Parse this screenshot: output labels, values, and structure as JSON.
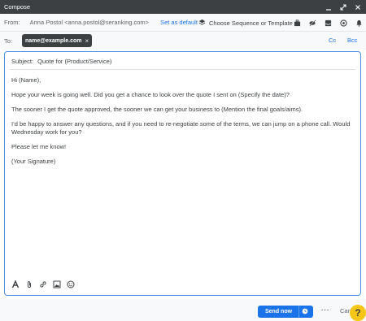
{
  "window": {
    "title": "Compose"
  },
  "from": {
    "label": "From:",
    "sender": "Anna Postol <anna.postol@seranking.com>",
    "set_default": "Set as default",
    "sequence_label": "Choose Sequence or Template"
  },
  "to": {
    "label": "To:",
    "recipient": "name@example.com",
    "cc": "Cc",
    "bcc": "Bcc"
  },
  "subject": {
    "label": "Subject:",
    "value": "Quote for (Product/Service)"
  },
  "body": {
    "greeting": "Hi (Name),",
    "p1": "Hope your week is going well. Did you get a chance to look over the quote I sent on (Specify the date)?",
    "p2": "The sooner I get the quote approved, the sooner we can get your business to (Mention the final goals/aims).",
    "p3": "I’d be happy to answer any questions, and if you need to re-negotiate some of the terms, we can jump on a phone call. Would Wednesday work for you?",
    "p4": "Please let me know!",
    "signature": "(Your Signature)"
  },
  "footer": {
    "send_label": "Send now",
    "more_label": "···",
    "cancel_label": "Can"
  },
  "help": {
    "label": "?"
  },
  "colors": {
    "accent": "#1a73e8",
    "titlebar": "#3c4043",
    "help": "#f5c518"
  }
}
